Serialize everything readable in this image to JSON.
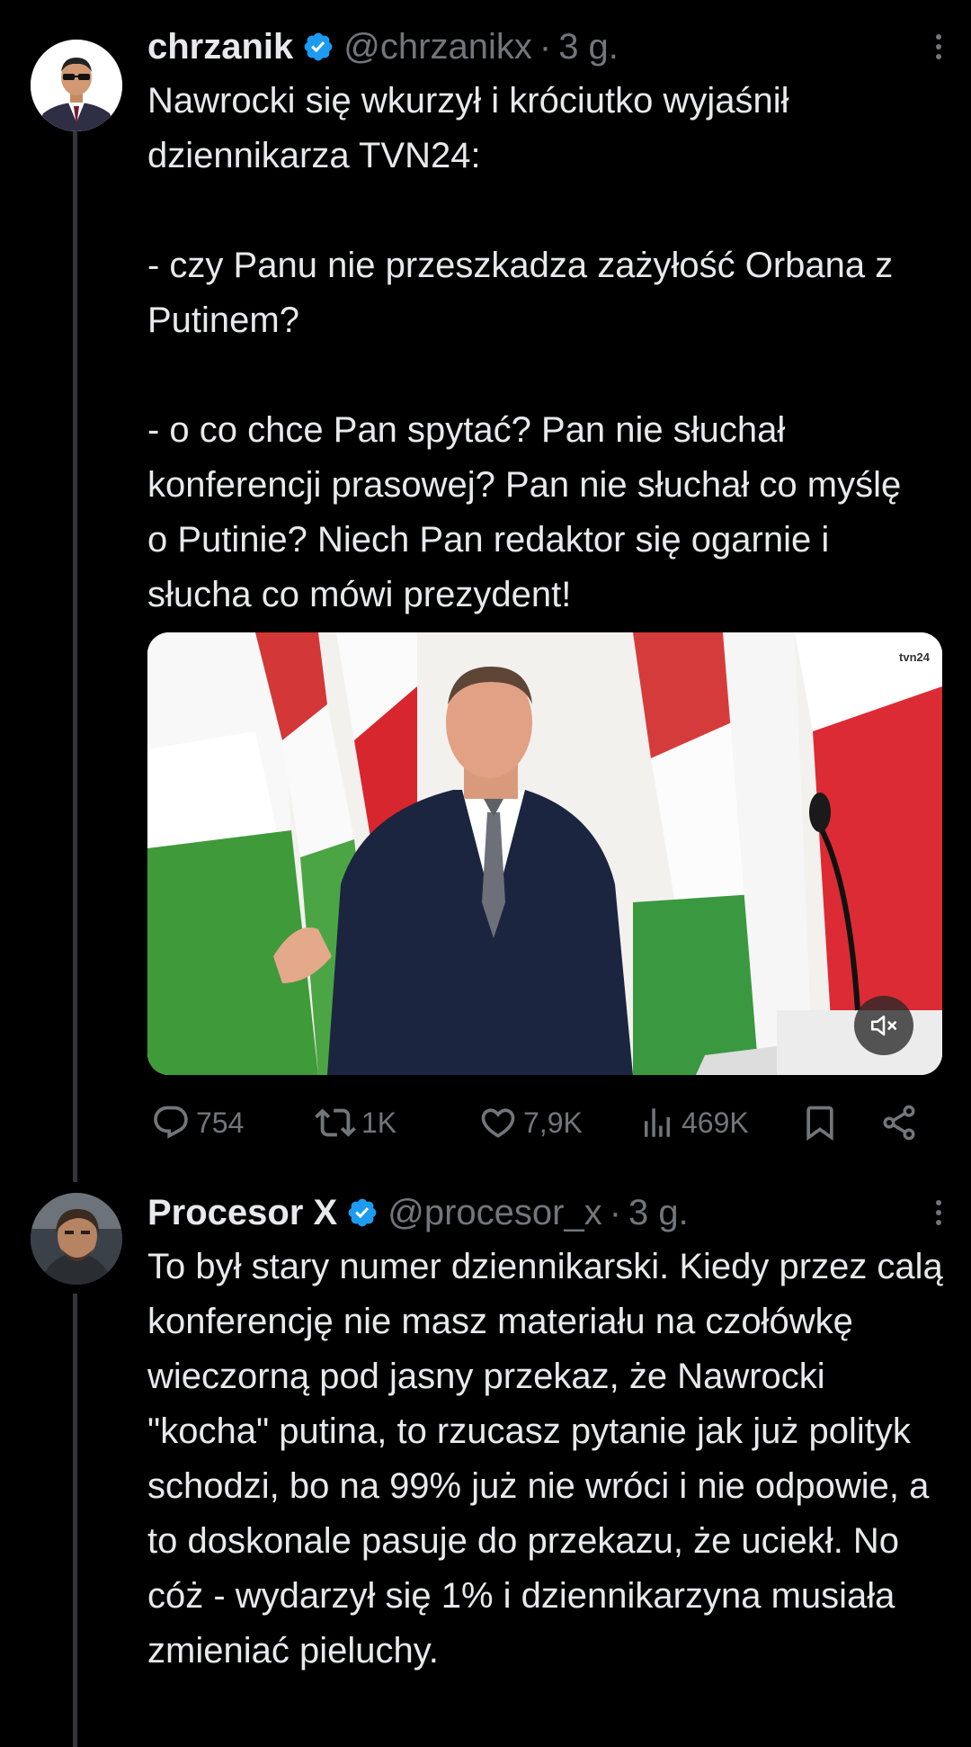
{
  "colors": {
    "background": "#000000",
    "text_primary": "#e7e9ea",
    "text_secondary": "#71767b",
    "verified_badge": "#1d9bf0",
    "thread_line": "#333639"
  },
  "tweets": [
    {
      "display_name": "chrzanik",
      "handle": "@chrzanikx",
      "separator": "·",
      "time": "3 g.",
      "verified_icon": "verified-badge-icon",
      "text": "Nawrocki się wkurzył i króciutko wyjaśnił dziennikarza TVN24:\n\n- czy Panu nie przeszkadza zażyłość Orbana z Putinem?\n\n- o co chce Pan spytać? Pan nie słuchał konferencji prasowej? Pan nie słuchał co myślę o Putinie? Niech Pan redaktor się ogarnie i słucha co mówi prezydent!",
      "media": {
        "type": "video",
        "watermark": "tvn24",
        "mute_icon": "speaker-muted-icon"
      },
      "actions": {
        "replies": "754",
        "reposts": "1K",
        "likes": "7,9K",
        "views": "469K"
      }
    },
    {
      "display_name": "Procesor X",
      "handle": "@procesor_x",
      "separator": "·",
      "time": "3 g.",
      "verified_icon": "verified-badge-icon",
      "text": "To był stary numer dziennikarski. Kiedy przez calą konferencję nie masz materiału na czołówkę wieczorną pod jasny przekaz, że Nawrocki \"kocha\" putina, to rzucasz pytanie jak już polityk schodzi, bo na 99% już nie wróci i nie odpowie, a to doskonale pasuje do przekazu, że uciekł. No cóż - wydarzył się 1% i dziennikarzyna musiała zmieniać pieluchy."
    }
  ]
}
